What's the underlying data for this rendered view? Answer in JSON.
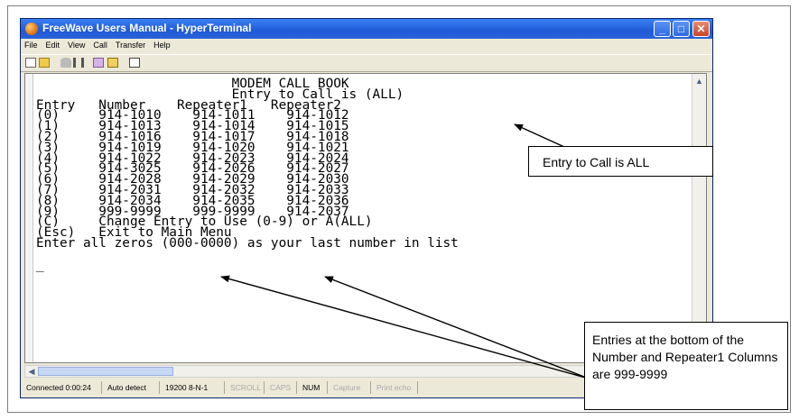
{
  "window": {
    "title": "FreeWave Users Manual - HyperTerminal",
    "controls": {
      "minimize": "_",
      "maximize": "□",
      "close": "✕"
    }
  },
  "menubar": [
    "File",
    "Edit",
    "View",
    "Call",
    "Transfer",
    "Help"
  ],
  "toolbar": [
    "new-icon",
    "open-icon",
    "call-icon",
    "disconnect-icon",
    "send-icon",
    "receive-icon",
    "properties-icon"
  ],
  "terminal": {
    "lines": [
      "                         MODEM CALL BOOK",
      "                         Entry to Call is (ALL)",
      "Entry   Number    Repeater1   Repeater2",
      "(0)     914-1010    914-1011    914-1012",
      "(1)     914-1013    914-1014    914-1015",
      "(2)     914-1016    914-1017    914-1018",
      "(3)     914-1019    914-1020    914-1021",
      "(4)     914-1022    914-2023    914-2024",
      "(5)     914-3025    914-2026    914-2027",
      "(6)     914-2028    914-2029    914-2030",
      "(7)     914-2031    914-2032    914-2033",
      "(8)     914-2034    914-2035    914-2036",
      "(9)     999-9999    999-9999    914-2037",
      "(C)     Change Entry to Use (0-9) or A(ALL)",
      "(Esc)   Exit to Main Menu",
      "Enter all zeros (000-0000) as your last number in list",
      "",
      "_"
    ]
  },
  "statusbar": {
    "connected": "Connected 0:00:24",
    "detect": "Auto detect",
    "settings": "19200 8-N-1",
    "scroll": "SCROLL",
    "caps": "CAPS",
    "num": "NUM",
    "capture": "Capture",
    "print": "Print echo"
  },
  "callouts": {
    "entry_to_call": "Entry to Call is ALL",
    "bottom_entries": "Entries at the bottom of the Number and Repeater1 Columns are 999-9999"
  }
}
